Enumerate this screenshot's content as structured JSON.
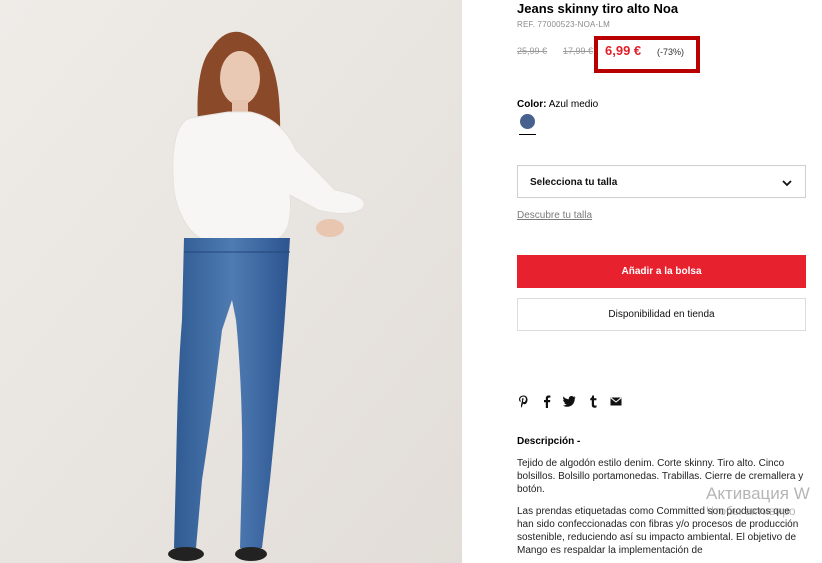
{
  "product": {
    "title": "Jeans skinny tiro alto Noa",
    "ref": "REF. 77000523-NOA-LM",
    "old_price_1": "25,99 €",
    "old_price_2": "17,99 €",
    "sale_price": "6,99 €",
    "discount": "(-73%)",
    "photo_alt": "",
    "colors": {
      "accent": "#e8212e",
      "highlight": "#b80000",
      "swatch": "#47628f"
    }
  },
  "color": {
    "label": "Color:",
    "value": "Azul medio"
  },
  "size": {
    "select_label": "Selecciona tu talla",
    "guide_link": "Descubre tu talla"
  },
  "actions": {
    "add_to_bag": "Añadir a la bolsa",
    "store_availability": "Disponibilidad en tienda"
  },
  "share": {
    "icons": [
      "pinterest-icon",
      "facebook-icon",
      "twitter-icon",
      "tumblr-icon",
      "email-icon"
    ]
  },
  "description": {
    "title": "Descripción -",
    "p1": "Tejido de algodón estilo denim. Corte skinny. Tiro alto. Cinco bolsillos. Bolsillo portamonedas. Trabillas. Cierre de cremallera y botón.",
    "p2": "Las prendas etiquetadas como Committed son productos que han sido confeccionadas con fibras y/o procesos de producción sostenible, reduciendo así su impacto ambiental. El objetivo de Mango es respaldar la implementación de"
  },
  "watermark": {
    "line1": "Активация W",
    "line2": "Чтобы активиро"
  }
}
